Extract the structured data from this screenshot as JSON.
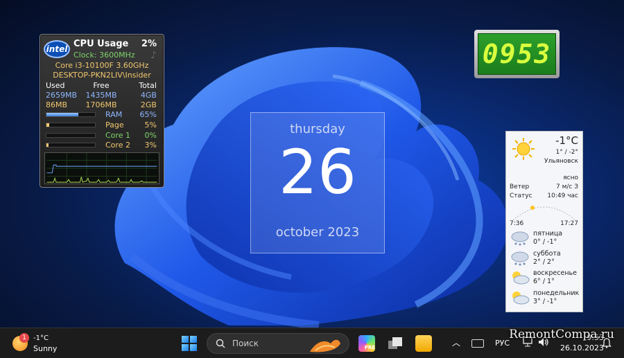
{
  "cpu_gadget": {
    "logo": "intel",
    "title": "CPU Usage",
    "usage_percent": "2%",
    "clock": "Clock: 3600MHz",
    "model": "Core i3-10100F 3.60GHz",
    "host": "DESKTOP-PKN2LIV\\Insider",
    "headers": [
      "Used",
      "Free",
      "Total"
    ],
    "physical": [
      "2659MB",
      "1435MB",
      "4GB"
    ],
    "virtual": [
      "86MB",
      "1706MB",
      "2GB"
    ],
    "bars": [
      {
        "label": "RAM",
        "value": "65%",
        "fill": 0.65
      },
      {
        "label": "Page",
        "value": "5%",
        "fill": 0.05
      },
      {
        "label": "Core 1",
        "value": "0%",
        "fill": 0.0
      },
      {
        "label": "Core 2",
        "value": "3%",
        "fill": 0.03
      }
    ]
  },
  "digital_clock": {
    "display": "0953"
  },
  "date_gadget": {
    "weekday": "thursday",
    "day": "26",
    "month_year": "october 2023"
  },
  "weather": {
    "temperature": "-1°C",
    "range": "1° / -2°",
    "city": "Ульяновск",
    "condition": "ясно",
    "wind_label": "Ветер",
    "wind_value": "7 м/с З",
    "status_label": "Статус",
    "status_value": "10:49 час",
    "sunrise": "7:36",
    "sunset": "17:27",
    "forecast": [
      {
        "day": "пятница",
        "temps": "0° / -1°",
        "icon": "snow-cloud-icon"
      },
      {
        "day": "суббота",
        "temps": "2° / 2°",
        "icon": "snow-cloud-icon"
      },
      {
        "day": "воскресенье",
        "temps": "6° / 1°",
        "icon": "sun-cloud-icon"
      },
      {
        "day": "понедельник",
        "temps": "3° / -1°",
        "icon": "sun-cloud-icon"
      }
    ]
  },
  "taskbar": {
    "weather_temp": "-1°C",
    "weather_text": "Sunny",
    "weather_badge": "1",
    "search_placeholder": "Поиск",
    "copilot_badge": "PRE",
    "language": "РУС",
    "time": "9:53",
    "date": "26.10.2023"
  },
  "watermark": "RemontCompa.ru"
}
